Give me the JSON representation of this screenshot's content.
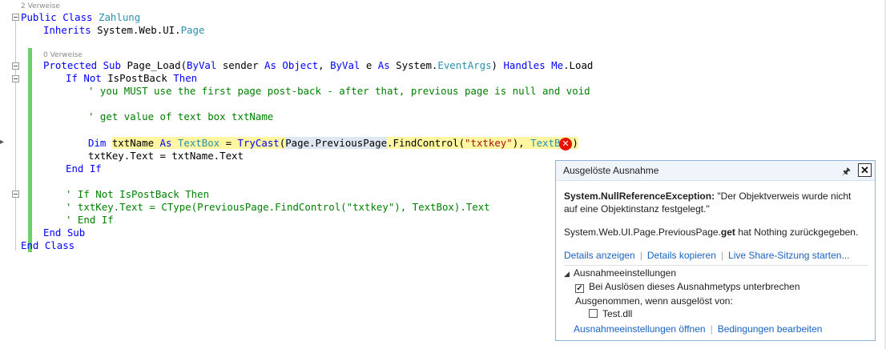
{
  "codelens": {
    "class_refs": "2 Verweise",
    "method_refs": "0 Verweise"
  },
  "code": {
    "l1_kw": "Public Class ",
    "l1_type": "Zahlung",
    "l2_kw": "Inherits ",
    "l2_ns": "System.Web.UI.",
    "l2_type": "Page",
    "l4_kw1": "Protected Sub ",
    "l4_name": "Page_Load(",
    "l4_kw2": "ByVal ",
    "l4_p1": "sender ",
    "l4_kw3": "As Object",
    "l4_sep": ", ",
    "l4_kw4": "ByVal ",
    "l4_p2": "e ",
    "l4_kw5": "As ",
    "l4_ns": "System.",
    "l4_type": "EventArgs",
    "l4_close": ") ",
    "l4_kw6": "Handles Me",
    "l4_end": ".Load",
    "l5_kw": "If Not ",
    "l5_id": "IsPostBack ",
    "l5_kw2": "Then",
    "l6_cm": "' you MUST use the first page post-back - after that, previous page is null and void",
    "l8_cm": "' get value of text box txtName",
    "l10_kw1": "Dim ",
    "l10_a": "txtName ",
    "l10_kw2": "As ",
    "l10_type": "TextBox",
    "l10_b": " = ",
    "l10_kw3": "TryCast",
    "l10_c": "(",
    "l10_ref": "Page.PreviousPage",
    "l10_d": ".FindControl(",
    "l10_str": "\"txtkey\"",
    "l10_e": "), ",
    "l10_type2": "TextBox",
    "l10_f": ")",
    "l11": "txtKey.Text = txtName.Text",
    "l12_kw": "End If",
    "l14_cm": "' If Not IsPostBack Then",
    "l15_cm": "' txtKey.Text = CType(PreviousPage.FindControl(\"txtkey\"), TextBox).Text",
    "l16_cm": "' End If",
    "l17_kw": "End Sub",
    "l18_kw": "End Class"
  },
  "popup": {
    "title": "Ausgelöste Ausnahme",
    "pin_glyph": "🖈",
    "close_glyph": "✕",
    "exception_type": "System.NullReferenceException:",
    "exception_msg": " \"Der Objektverweis wurde nicht auf eine Objektinstanz festgelegt.\"",
    "detail_prefix": "System.Web.UI.Page.PreviousPage.",
    "detail_bold": "get",
    "detail_suffix": " hat Nothing zurückgegeben.",
    "link_details": "Details anzeigen",
    "link_copy": "Details kopieren",
    "link_share": "Live Share-Sitzung starten...",
    "settings_title": "Ausnahmeeinstellungen",
    "break_label": "Bei Auslösen dieses Ausnahmetyps unterbrechen",
    "break_checked": true,
    "except_label": "Ausgenommen, wenn ausgelöst von:",
    "dll_label": "Test.dll",
    "dll_checked": false,
    "link_open_settings": "Ausnahmeeinstellungen öffnen",
    "link_conditions": "Bedingungen bearbeiten"
  },
  "colors": {
    "keyword": "#0000ff",
    "type": "#2b91af",
    "comment": "#008000",
    "string": "#a31515",
    "highlight": "#fff6a1",
    "error": "#e51400",
    "link": "#1a63c1"
  }
}
